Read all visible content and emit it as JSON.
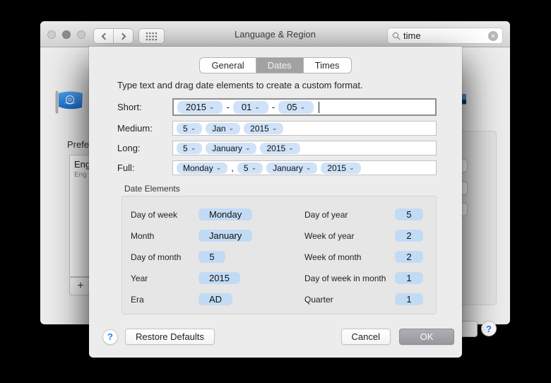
{
  "window": {
    "title": "Language & Region",
    "search": {
      "value": "time",
      "icon": "magnifier-icon",
      "clear_icon": "clear-circle-icon"
    },
    "preferred_label": "Prefe",
    "language_primary": "Eng",
    "language_secondary": "Eng",
    "add_label": "+",
    "help_label": "?"
  },
  "sheet": {
    "tabs": [
      {
        "label": "General",
        "selected": false
      },
      {
        "label": "Dates",
        "selected": true
      },
      {
        "label": "Times",
        "selected": false
      }
    ],
    "instruction": "Type text and drag date elements to create a custom format.",
    "format_rows": [
      {
        "label": "Short:",
        "focused": true,
        "segments": [
          {
            "t": "token",
            "text": "2015"
          },
          {
            "t": "sep",
            "text": "-"
          },
          {
            "t": "token",
            "text": "01"
          },
          {
            "t": "sep",
            "text": "-"
          },
          {
            "t": "token",
            "text": "05"
          },
          {
            "t": "cursor"
          }
        ]
      },
      {
        "label": "Medium:",
        "focused": false,
        "segments": [
          {
            "t": "token",
            "text": "5"
          },
          {
            "t": "token",
            "text": "Jan"
          },
          {
            "t": "token",
            "text": "2015"
          }
        ]
      },
      {
        "label": "Long:",
        "focused": false,
        "segments": [
          {
            "t": "token",
            "text": "5"
          },
          {
            "t": "token",
            "text": "January"
          },
          {
            "t": "token",
            "text": "2015"
          }
        ]
      },
      {
        "label": "Full:",
        "focused": false,
        "segments": [
          {
            "t": "token",
            "text": "Monday"
          },
          {
            "t": "sep",
            "text": ","
          },
          {
            "t": "token",
            "text": "5"
          },
          {
            "t": "token",
            "text": "January"
          },
          {
            "t": "token",
            "text": "2015"
          }
        ]
      }
    ],
    "date_elements": {
      "title": "Date Elements",
      "left": [
        {
          "label": "Day of week",
          "value": "Monday"
        },
        {
          "label": "Month",
          "value": "January"
        },
        {
          "label": "Day of month",
          "value": "5"
        },
        {
          "label": "Year",
          "value": "2015"
        },
        {
          "label": "Era",
          "value": "AD"
        }
      ],
      "right": [
        {
          "label": "Day of year",
          "value": "5"
        },
        {
          "label": "Week of year",
          "value": "2"
        },
        {
          "label": "Week of month",
          "value": "2"
        },
        {
          "label": "Day of week in month",
          "value": "1"
        },
        {
          "label": "Quarter",
          "value": "1"
        }
      ]
    },
    "footer": {
      "help": "?",
      "restore": "Restore Defaults",
      "cancel": "Cancel",
      "ok": "OK"
    }
  },
  "colors": {
    "token_blue": "#cfe2f7",
    "pill_blue": "#c2dbf4",
    "selected_tab_gray": "#a2a2a2",
    "ok_button_gray": "#9b9ba0",
    "help_blue": "#2f7cf6",
    "sheet_bg": "#ececec"
  }
}
